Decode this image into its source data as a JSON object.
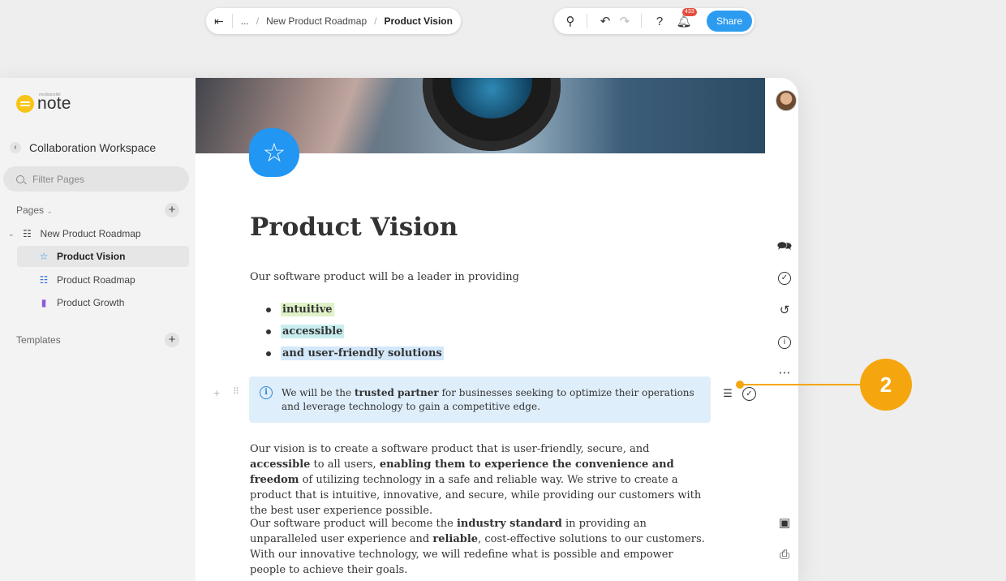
{
  "logo": {
    "name": "note",
    "sub": "mediatoolkit"
  },
  "sidebar": {
    "workspace_title": "Collaboration Workspace",
    "filter_placeholder": "Filter Pages",
    "pages_label": "Pages",
    "pages_caret": "⌄",
    "templates_label": "Templates",
    "tree": [
      {
        "label": "New Product Roadmap",
        "icon": "roadmap-icon"
      },
      {
        "label": "Product Vision",
        "icon": "star-icon",
        "active": true
      },
      {
        "label": "Product Roadmap",
        "icon": "roadmap-icon"
      },
      {
        "label": "Product Growth",
        "icon": "chart-bars-icon"
      }
    ]
  },
  "toolbar": {
    "breadcrumb_ellipsis": "...",
    "breadcrumb_parent": "New Product Roadmap",
    "breadcrumb_current": "Product Vision",
    "notifications_count": "433",
    "share_label": "Share"
  },
  "doc": {
    "title": "Product Vision",
    "intro": "Our software product will be a leader in providing",
    "bullets": [
      {
        "text": "intuitive",
        "color": "#dff2c8"
      },
      {
        "text": "accessible",
        "color": "#c8eef0"
      },
      {
        "text": "and user-friendly solutions",
        "color": "#d3e8fb"
      }
    ],
    "callout": {
      "pre": "We will be the ",
      "bold": "trusted partner",
      "post": " for businesses seeking to optimize their operations and leverage technology to gain a competitive edge."
    },
    "para1": {
      "a": "Our vision is to create a software product that is user-friendly, secure, and ",
      "b": "accessible",
      "c": " to all users, ",
      "d": "enabling them to experience the convenience and freedom",
      "e": " of utilizing technology in a safe and reliable way. We strive to create a product that is intuitive, innovative, and secure, while providing our customers with the best user experience possible."
    },
    "para2": {
      "a": "Our software product will become the ",
      "b": "industry standard",
      "c": " in providing an unparalleled user experience and ",
      "d": "reliable",
      "e": ", cost-effective solutions to our customers. With our innovative technology, we will redefine what is possible and empower people to achieve their goals."
    }
  },
  "annotation": {
    "number": "2",
    "color": "#f5a60f"
  },
  "colors": {
    "accent": "#2d9cf0",
    "page_icon": "#2196f3",
    "callout_bg": "#dfeefb"
  }
}
